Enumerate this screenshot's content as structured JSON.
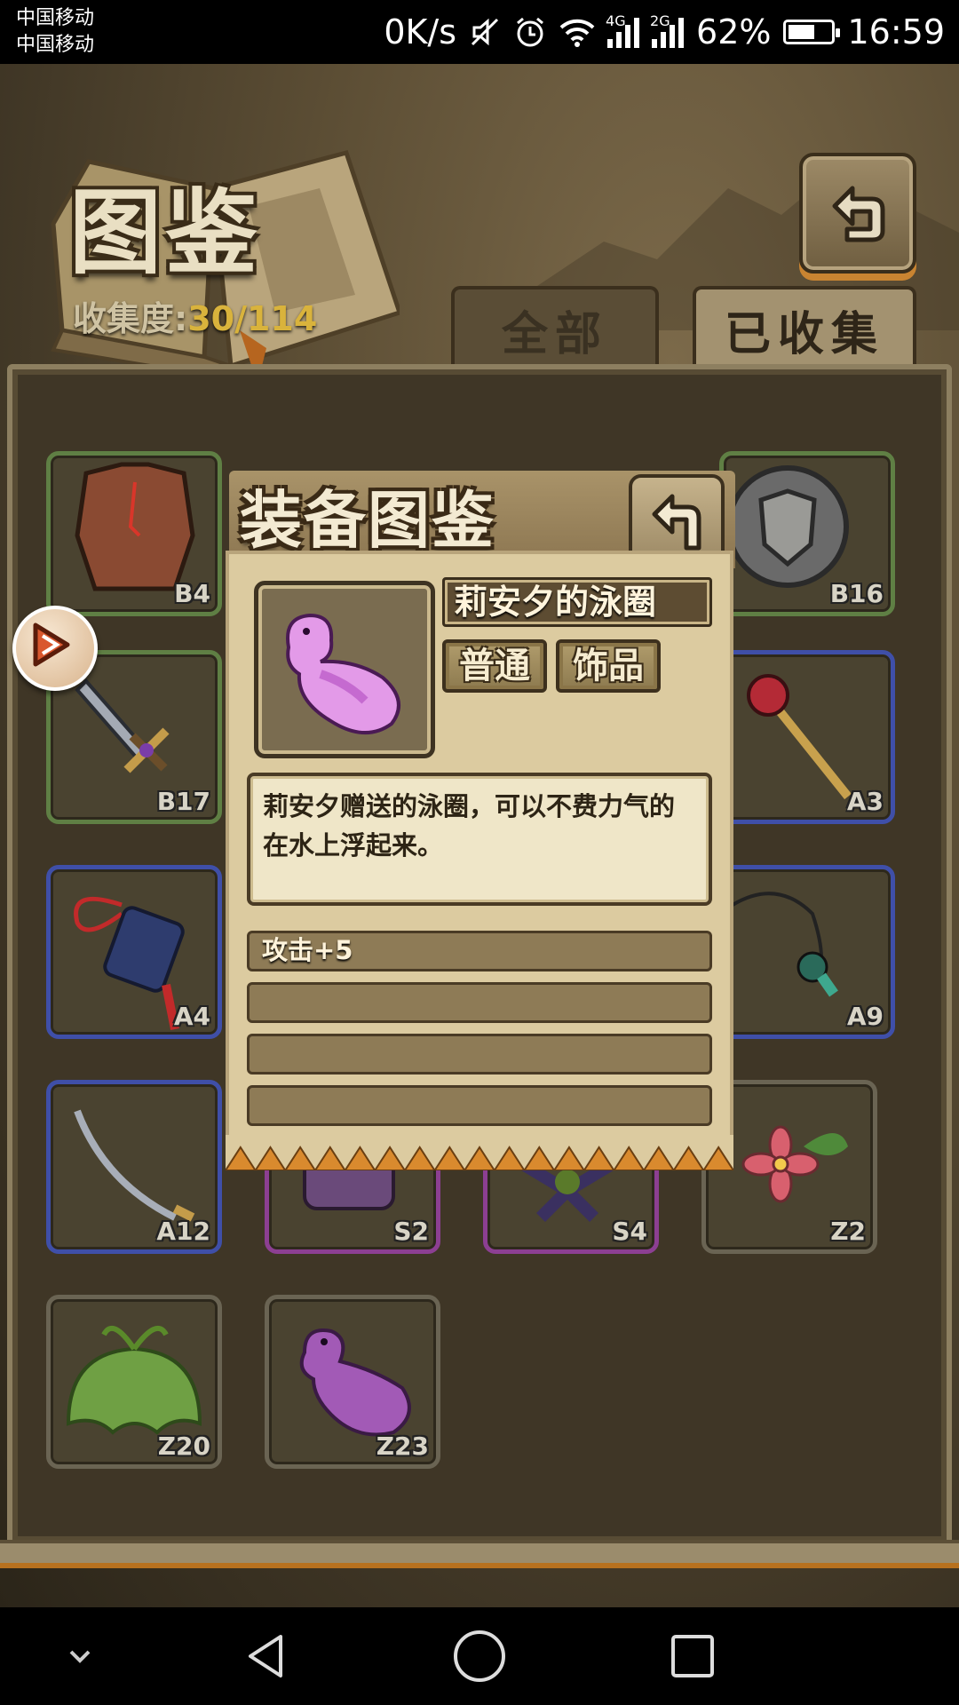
{
  "status_bar": {
    "carrier_1": "中国移动",
    "carrier_2": "中国移动",
    "net_speed": "0K/s",
    "signal_1_tag": "4G",
    "signal_2_tag": "2G",
    "battery": "62%",
    "battery_level": 0.62,
    "time": "16:59"
  },
  "header": {
    "title": "图鉴",
    "collect_label": "收集度:",
    "collect_value": "30/114"
  },
  "tabs": [
    {
      "label": "全部",
      "active": false
    },
    {
      "label": "已收集",
      "active": true
    }
  ],
  "grid_items": [
    {
      "code": "B4",
      "rarity_color": "green",
      "icon": "chest-armor-icon"
    },
    {
      "code": "B16",
      "rarity_color": "green",
      "icon": "round-shield-icon"
    },
    {
      "code": "B17",
      "rarity_color": "green",
      "icon": "sword-icon"
    },
    {
      "code": "A3",
      "rarity_color": "blue",
      "icon": "scepter-icon"
    },
    {
      "code": "A4",
      "rarity_color": "blue",
      "icon": "charm-tassel-icon"
    },
    {
      "code": "A9",
      "rarity_color": "blue",
      "icon": "spider-necklace-icon"
    },
    {
      "code": "A12",
      "rarity_color": "blue",
      "icon": "saber-icon"
    },
    {
      "code": "S2",
      "rarity_color": "purple",
      "icon": "gauntlet-icon"
    },
    {
      "code": "S4",
      "rarity_color": "purple",
      "icon": "feather-plant-icon"
    },
    {
      "code": "Z2",
      "rarity_color": "grey",
      "icon": "flower-icon"
    },
    {
      "code": "Z20",
      "rarity_color": "grey",
      "icon": "leaf-jelly-icon"
    },
    {
      "code": "Z23",
      "rarity_color": "grey",
      "icon": "swim-ring-icon"
    }
  ],
  "modal": {
    "title": "装备图鉴",
    "item_name": "莉安夕的泳圈",
    "rarity": "普通",
    "type": "饰品",
    "description": "莉安夕赠送的泳圈，可以不费力气的在水上浮起来。",
    "stats": [
      "攻击+5",
      "",
      "",
      ""
    ]
  },
  "colors": {
    "grid_green": "#5f7f44",
    "grid_blue": "#3f4fa8",
    "grid_purple": "#8c3f92",
    "collect_value": "#d9b33c"
  }
}
